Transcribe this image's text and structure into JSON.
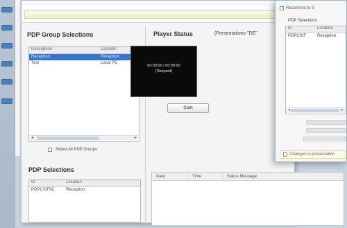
{
  "background_app": {},
  "main": {
    "group_panel": {
      "title": "PDP Group Selections",
      "columns": [
        "Description",
        "Location"
      ],
      "rows": [
        {
          "description": "Reception",
          "location": "Reception",
          "selected": true
        },
        {
          "description": "Test",
          "location": "Local PC",
          "selected": false
        }
      ],
      "checkbox_label": "Select All PDP Groups"
    },
    "selections_panel": {
      "title": "PDP Selections",
      "columns": [
        "Id",
        "Location"
      ],
      "rows": [
        {
          "id": "PDPCSIF9C",
          "location": "Reception"
        }
      ]
    },
    "player_status": {
      "title": "Player Status",
      "subtitle": "(Presentations \"DE\""
    },
    "player_screen": {
      "line1": "00:00:00 / 00:00:00",
      "line2": "(Stopped)"
    },
    "start_button_label": "Start",
    "log_table": {
      "columns": [
        "Date",
        "Time",
        "Status Message"
      ]
    }
  },
  "dialog": {
    "top_label": "Reconnect to S",
    "list_title": "PDP Selections",
    "columns": [
      "Id",
      "Location"
    ],
    "rows": [
      {
        "id": "PDPCSIF",
        "location": "Reception"
      }
    ],
    "footer_text": "Changes to presentation"
  },
  "colors": {
    "selection": "#3b75c9",
    "screen": "#0a0a0a",
    "notice_bar": "#fbfbe6"
  }
}
